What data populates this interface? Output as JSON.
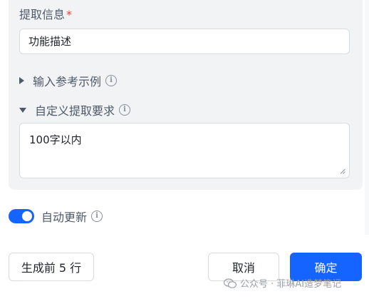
{
  "form": {
    "extract_label": "提取信息",
    "required_mark": "*",
    "extract_value": "功能描述",
    "example_section_label": "输入参考示例",
    "custom_section_label": "自定义提取要求",
    "custom_value": "100字以内",
    "info_glyph": "i"
  },
  "settings": {
    "auto_update_label": "自动更新",
    "auto_update_on": true
  },
  "footer": {
    "preview_label": "生成前 5 行",
    "cancel_label": "取消",
    "confirm_label": "确定"
  },
  "watermark": {
    "text": "公众号 · 菲琳AI造梦笔记",
    "icon": "wechat-icon"
  },
  "colors": {
    "accent": "#1664ff",
    "required": "#f53f3f",
    "panel": "#f2f3f5"
  }
}
